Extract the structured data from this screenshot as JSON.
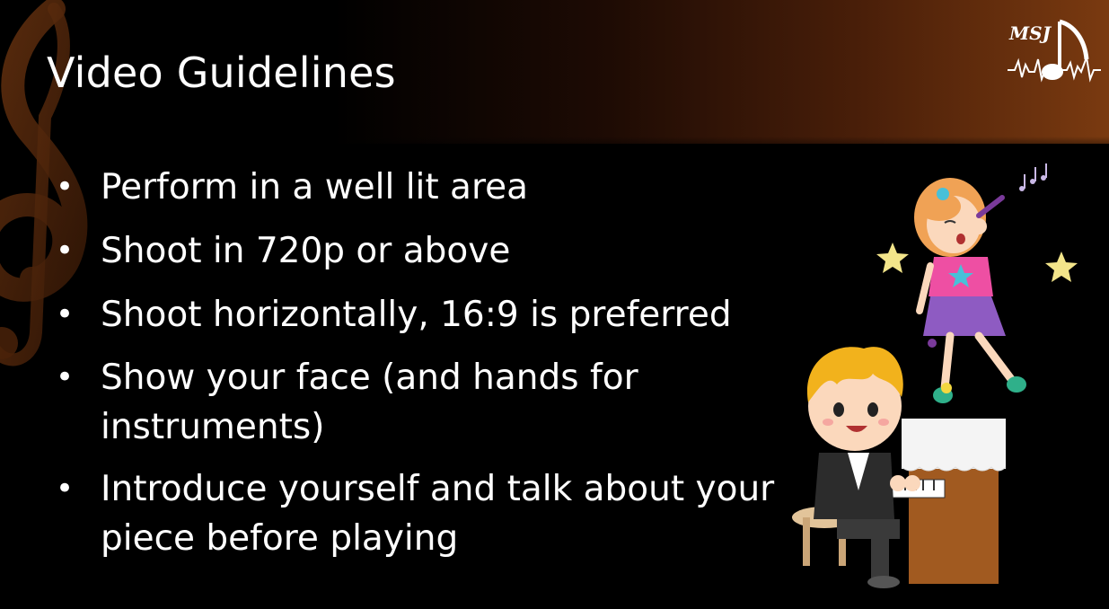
{
  "slide": {
    "title": "Video Guidelines",
    "logo_text": "MSJ",
    "bullets": [
      "Perform in a well lit area",
      "Shoot in 720p or above",
      "Shoot horizontally, 16:9 is preferred",
      "Show your face (and hands for instruments)",
      "Introduce yourself and talk about your piece before playing"
    ]
  },
  "colors": {
    "background": "#000000",
    "header_accent": "#7a3a10",
    "text": "#ffffff"
  },
  "icons": [
    "treble-clef-icon",
    "msj-logo-icon",
    "singing-girl-illustration",
    "piano-boy-illustration",
    "star-icon",
    "music-note-icon"
  ]
}
